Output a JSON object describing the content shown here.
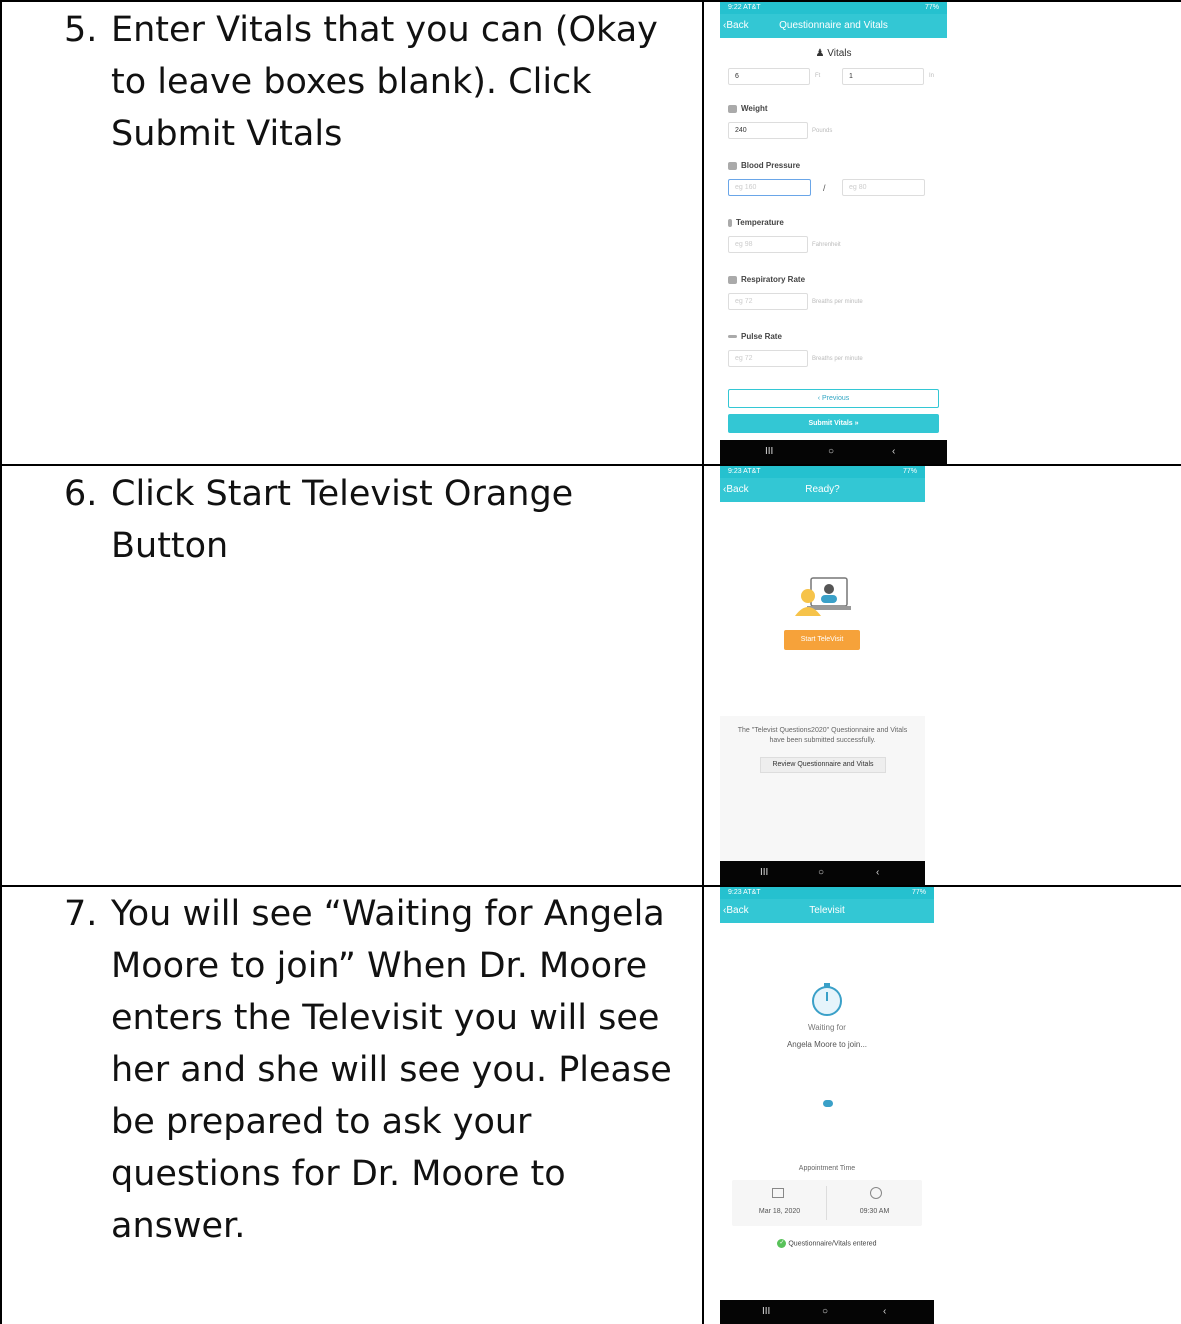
{
  "steps": [
    {
      "num": "5.",
      "text": "Enter Vitals that you can (Okay to leave boxes blank). Click Submit Vitals"
    },
    {
      "num": "6.",
      "text": "Click Start Televist Orange Button"
    },
    {
      "num": "7.",
      "text": "You will see “Waiting for Angela Moore to join”  When Dr. Moore enters the Televisit you will see her and she will see you. Please be prepared to ask your questions for Dr. Moore to answer."
    }
  ],
  "shot1": {
    "status_left": "9:22 AT&T",
    "status_right": "77%",
    "back": "Back",
    "title": "Questionnaire and Vitals",
    "section": "Vitals",
    "height_ft": "6",
    "ft_unit": "Ft",
    "height_in": "1",
    "in_unit": "In",
    "weight_label": "Weight",
    "weight_value": "240",
    "weight_unit": "Pounds",
    "bp_label": "Blood Pressure",
    "bp_sys_ph": "eg 160",
    "bp_sep": "/",
    "bp_dia_ph": "eg 80",
    "temp_label": "Temperature",
    "temp_ph": "eg 98",
    "temp_unit": "Fahrenheit",
    "resp_label": "Respiratory Rate",
    "resp_ph": "eg 72",
    "resp_unit": "Breaths per minute",
    "pulse_label": "Pulse Rate",
    "pulse_ph": "eg 72",
    "pulse_unit": "Breaths per minute",
    "previous": "‹ Previous",
    "submit": "Submit Vitals »"
  },
  "shot2": {
    "status_left": "9:23 AT&T",
    "status_right": "77%",
    "back": "Back",
    "title": "Ready?",
    "start": "Start TeleVisit",
    "message": "The \"Televist Questions2020\" Questionnaire and Vitals have been submitted successfully.",
    "review": "Review Questionnaire and Vitals"
  },
  "shot3": {
    "status_left": "9:23 AT&T",
    "status_right": "77%",
    "back": "Back",
    "title": "Televisit",
    "waiting1": "Waiting for",
    "waiting2": "Angela Moore to join...",
    "appt_label": "Appointment Time",
    "date": "Mar 18, 2020",
    "time": "09:30 AM",
    "entered": "Questionnaire/Vitals entered"
  },
  "nav": {
    "recents": "III",
    "home": "○",
    "back": "‹"
  },
  "colors": {
    "teal": "#33c7d4",
    "orange": "#f6a23a",
    "green": "#58c25a"
  }
}
